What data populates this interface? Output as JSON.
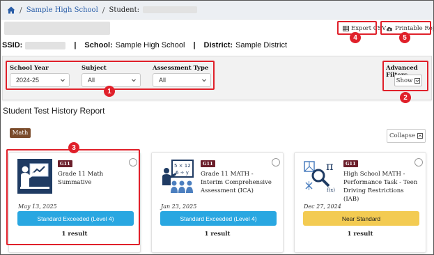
{
  "breadcrumb": {
    "home_icon": "home-icon",
    "school": "Sample High School",
    "student_label": "Student:"
  },
  "header": {
    "export_label": "Export CSV",
    "export_icon": "table-icon",
    "reports_label": "Printable Reports",
    "reports_icon": "cloud-download-icon"
  },
  "student_info": {
    "ssid_label": "SSID:",
    "school_label": "School:",
    "school_value": "Sample High School",
    "district_label": "District:",
    "district_value": "Sample District"
  },
  "filters": {
    "school_year": {
      "label": "School Year",
      "value": "2024-25"
    },
    "subject": {
      "label": "Subject",
      "value": "All"
    },
    "assessment_type": {
      "label": "Assessment Type",
      "value": "All"
    },
    "advanced_label": "Advanced Filters",
    "show_label": "Show"
  },
  "report": {
    "title": "Student Test History Report",
    "subject_badge": "Math",
    "collapse_label": "Collapse"
  },
  "cards": [
    {
      "grade": "G11",
      "title": "Grade 11 Math Summative",
      "date": "May 13, 2025",
      "result": "Standard Exceeded (Level 4)",
      "result_color": "#29a7e1",
      "count": "1 result",
      "icon": "teacher-presentation-icon"
    },
    {
      "grade": "G11",
      "title": "Grade 11 MATH - Interim Comprehensive Assessment (ICA)",
      "date": "Jan 23, 2025",
      "result": "Standard Exceeded (Level 4)",
      "result_color": "#29a7e1",
      "count": "1 result",
      "icon": "math-class-icon",
      "board_text": [
        "5 × 12",
        "6 ÷ y"
      ]
    },
    {
      "grade": "G11",
      "title": "High School MATH - Performance Task - Teen Driving Restrictions (IAB)",
      "date": "Dec 27, 2024",
      "result": "Near Standard",
      "result_color": "#f3cb52",
      "count": "1 result",
      "icon": "math-symbols-icon",
      "symbols": [
        "π",
        "f(x)"
      ]
    }
  ],
  "annotations": [
    "1",
    "2",
    "3",
    "4",
    "5"
  ],
  "colors": {
    "link": "#2a5ea8",
    "highlight": "#e0202a",
    "grade_badge": "#6b1f2b",
    "math_badge": "#7a4b2a",
    "icon_navy": "#1f3b63"
  }
}
